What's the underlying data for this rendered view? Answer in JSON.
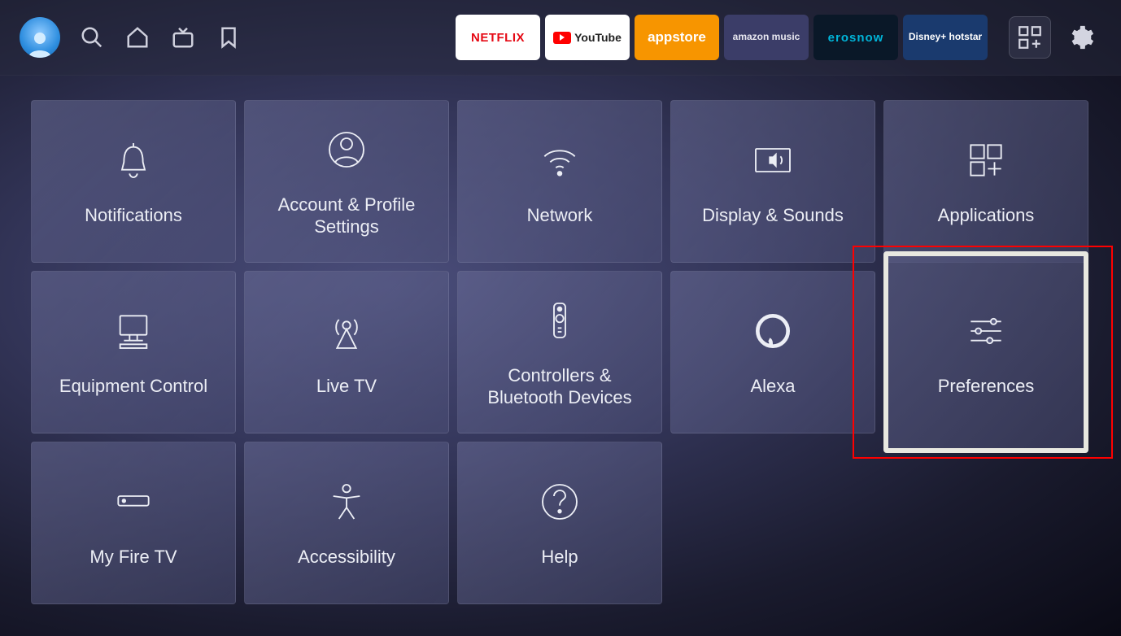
{
  "topbar": {
    "apps": {
      "netflix": "NETFLIX",
      "youtube": "YouTube",
      "appstore": "appstore",
      "amazonmusic": "amazon music",
      "erosnow": "erosnow",
      "hotstar": "Disney+ hotstar"
    }
  },
  "settings": {
    "tiles": [
      {
        "id": "notifications",
        "label": "Notifications",
        "icon": "bell"
      },
      {
        "id": "account",
        "label": "Account & Profile Settings",
        "icon": "profile"
      },
      {
        "id": "network",
        "label": "Network",
        "icon": "wifi"
      },
      {
        "id": "display",
        "label": "Display & Sounds",
        "icon": "display"
      },
      {
        "id": "applications",
        "label": "Applications",
        "icon": "apps"
      },
      {
        "id": "equipment",
        "label": "Equipment Control",
        "icon": "equipment"
      },
      {
        "id": "livetv",
        "label": "Live TV",
        "icon": "antenna"
      },
      {
        "id": "controllers",
        "label": "Controllers & Bluetooth Devices",
        "icon": "remote"
      },
      {
        "id": "alexa",
        "label": "Alexa",
        "icon": "alexa"
      },
      {
        "id": "preferences",
        "label": "Preferences",
        "icon": "sliders",
        "selected": true
      },
      {
        "id": "myfiretv",
        "label": "My Fire TV",
        "icon": "firetv"
      },
      {
        "id": "accessibility",
        "label": "Accessibility",
        "icon": "accessibility"
      },
      {
        "id": "help",
        "label": "Help",
        "icon": "help"
      }
    ]
  }
}
